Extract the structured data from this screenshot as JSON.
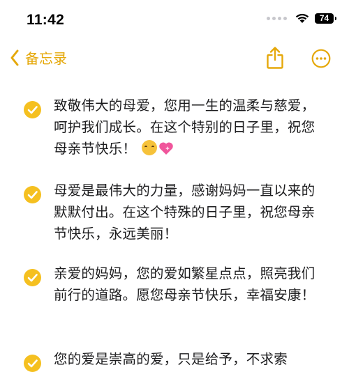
{
  "status_bar": {
    "time": "11:42",
    "battery": "74"
  },
  "nav": {
    "back_label": "备忘录",
    "accent_color": "#e5a80a"
  },
  "notes": [
    {
      "text": "致敬伟大的母爱，您用一生的温柔与慈爱，呵护我们成长。在这个特别的日子里，祝您母亲节快乐！",
      "emojis": [
        "smiling-face-emoji",
        "sparkling-heart-emoji"
      ]
    },
    {
      "text": "母爱是最伟大的力量，感谢妈妈一直以来的默默付出。在这个特殊的日子里，祝您母亲节快乐，永远美丽！"
    },
    {
      "text": "亲爱的妈妈，您的爱如繁星点点，照亮我们前行的道路。愿您母亲节快乐，幸福安康！"
    },
    {
      "text": "您的爱是崇高的爱，只是给予，不求索"
    }
  ],
  "colors": {
    "check": "#f5c020",
    "text": "#1c1c1e"
  }
}
